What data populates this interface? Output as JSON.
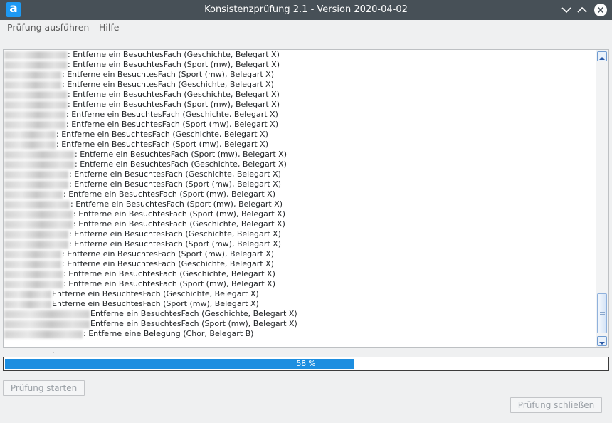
{
  "window": {
    "title": "Konsistenzprüfung 2.1 - Version 2020-04-02",
    "app_icon_letter": "a"
  },
  "menu": {
    "items": [
      "Prüfung ausführen",
      "Hilfe"
    ]
  },
  "log": {
    "lines": [
      {
        "text": ": Entferne ein BesuchtesFach (Geschichte, Belegart X)"
      },
      {
        "text": ": Entferne ein BesuchtesFach (Sport (mw), Belegart X)"
      },
      {
        "text": ": Entferne ein BesuchtesFach (Sport (mw), Belegart X)"
      },
      {
        "text": ": Entferne ein BesuchtesFach (Geschichte, Belegart X)"
      },
      {
        "text": ": Entferne ein BesuchtesFach (Geschichte, Belegart X)"
      },
      {
        "text": ": Entferne ein BesuchtesFach (Sport (mw), Belegart X)"
      },
      {
        "text": ": Entferne ein BesuchtesFach (Geschichte, Belegart X)"
      },
      {
        "text": ": Entferne ein BesuchtesFach (Sport (mw), Belegart X)"
      },
      {
        "text": ": Entferne ein BesuchtesFach (Geschichte, Belegart X)"
      },
      {
        "text": ": Entferne ein BesuchtesFach (Sport (mw), Belegart X)"
      },
      {
        "text": ": Entferne ein BesuchtesFach (Sport (mw), Belegart X)"
      },
      {
        "text": ": Entferne ein BesuchtesFach (Geschichte, Belegart X)"
      },
      {
        "text": ": Entferne ein BesuchtesFach (Geschichte, Belegart X)"
      },
      {
        "text": ": Entferne ein BesuchtesFach (Sport (mw), Belegart X)"
      },
      {
        "text": ": Entferne ein BesuchtesFach (Sport (mw), Belegart X)"
      },
      {
        "text": ": Entferne ein BesuchtesFach (Sport (mw), Belegart X)"
      },
      {
        "text": ": Entferne ein BesuchtesFach (Sport (mw), Belegart X)"
      },
      {
        "text": ": Entferne ein BesuchtesFach (Geschichte, Belegart X)"
      },
      {
        "text": ": Entferne ein BesuchtesFach (Geschichte, Belegart X)"
      },
      {
        "text": ": Entferne ein BesuchtesFach (Sport (mw), Belegart X)"
      },
      {
        "text": ": Entferne ein BesuchtesFach (Sport (mw), Belegart X)"
      },
      {
        "text": ": Entferne ein BesuchtesFach (Geschichte, Belegart X)"
      },
      {
        "text": ": Entferne ein BesuchtesFach (Geschichte, Belegart X)"
      },
      {
        "text": ": Entferne ein BesuchtesFach (Sport (mw), Belegart X)"
      },
      {
        "text": " Entferne ein BesuchtesFach (Geschichte, Belegart X)"
      },
      {
        "text": " Entferne ein BesuchtesFach (Sport (mw), Belegart X)"
      },
      {
        "text": " Entferne ein BesuchtesFach (Geschichte, Belegart X)"
      },
      {
        "text": " Entferne ein BesuchtesFach (Sport (mw), Belegart X)"
      },
      {
        "text": ": Entferne eine Belegung (Chor, Belegart B)"
      }
    ]
  },
  "progress": {
    "value": 0.58,
    "label": "58 %"
  },
  "buttons": {
    "start": "Prüfung starten",
    "close": "Prüfung schließen"
  },
  "colors": {
    "titlebar": "#475057",
    "accent": "#1d8ee0",
    "window_bg": "#eff0f1"
  },
  "icons": {
    "minimize": "chevron-down-icon",
    "maximize": "chevron-up-icon",
    "close": "close-icon"
  }
}
